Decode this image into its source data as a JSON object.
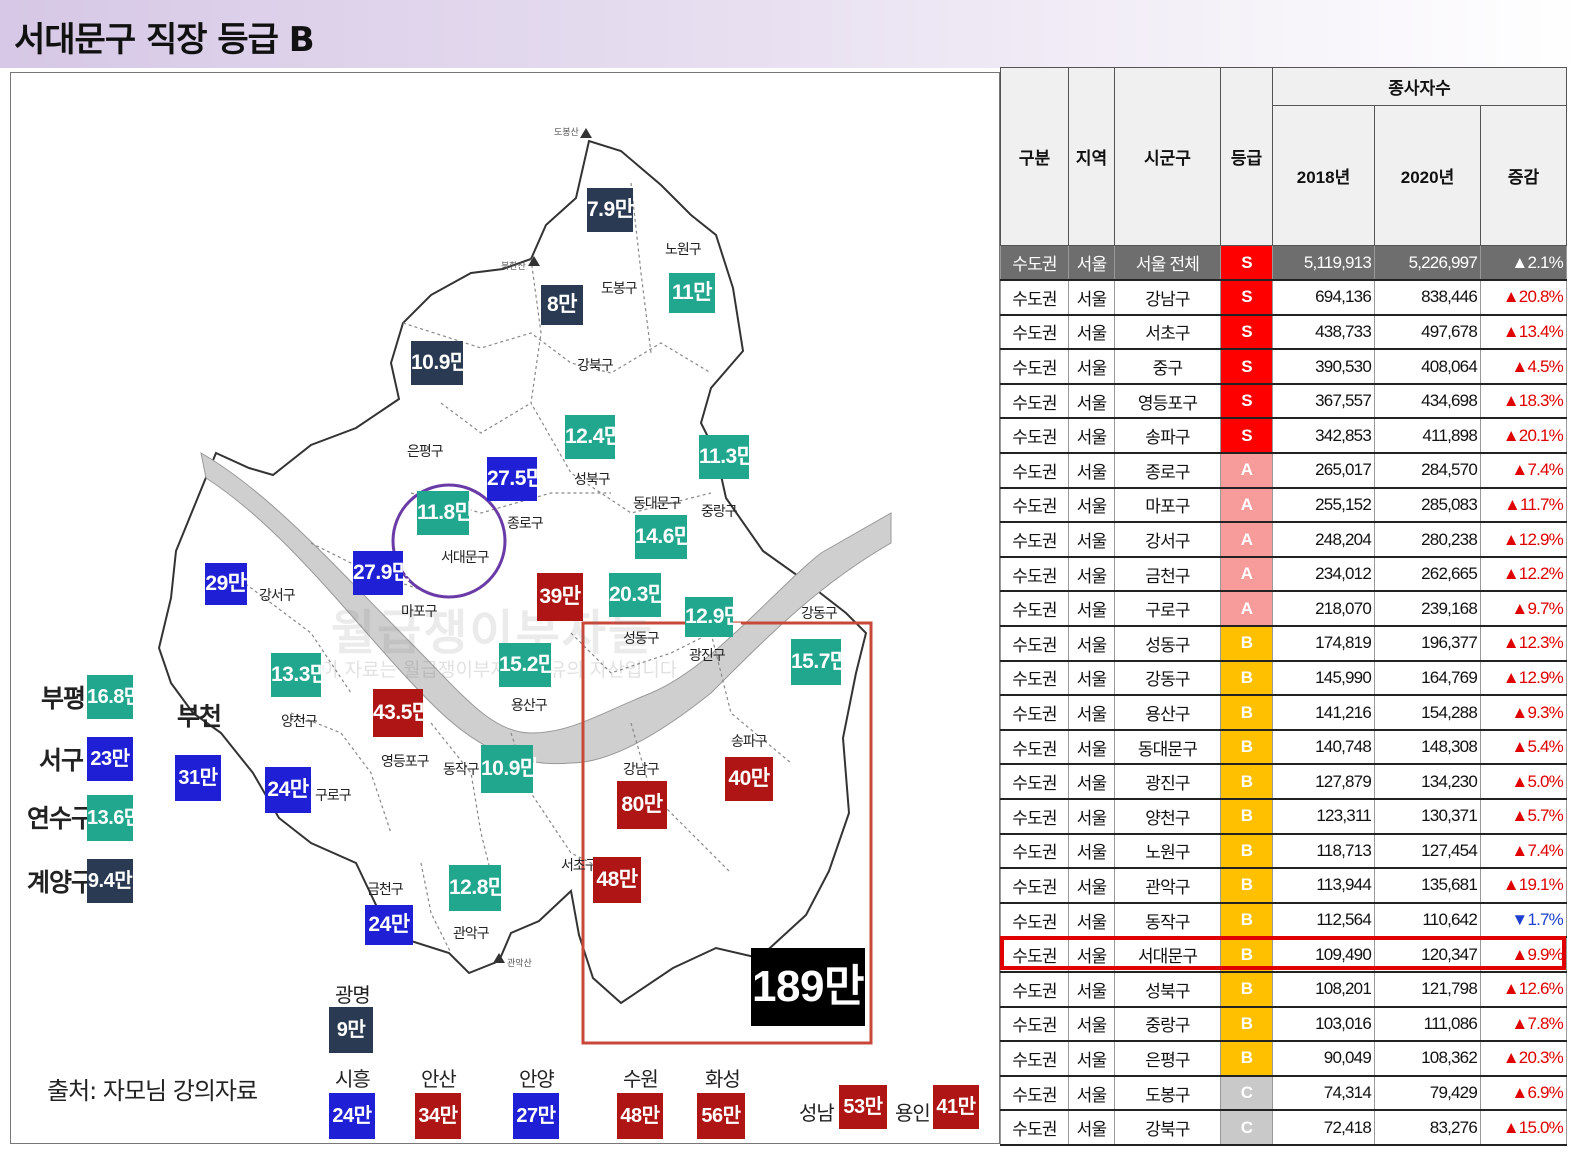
{
  "page": {
    "title": "서대문구 직장 등급 B"
  },
  "map": {
    "mountains": [
      "도봉산",
      "북한산",
      "관악산"
    ],
    "districts": [
      "노원구",
      "도봉구",
      "강북구",
      "은평구",
      "성북구",
      "종로구",
      "동대문구",
      "중랑구",
      "서대문구",
      "강서구",
      "마포구",
      "성동구",
      "광진구",
      "강동구",
      "양천구",
      "용산구",
      "영등포구",
      "동작구",
      "구로구",
      "송파구",
      "강남구",
      "서초구",
      "금천구",
      "관악구"
    ],
    "values": {
      "dobong": "7.9만",
      "gangbuk": "8만",
      "nowon": "11만",
      "eunpyeong": "10.9만",
      "seongbuk": "12.4만",
      "jungnang": "11.3만",
      "jongno": "27.5만",
      "seodaemun": "11.8만",
      "dongdaemun": "14.6만",
      "gangseo": "29만",
      "mapo": "27.9만",
      "jung": "39만",
      "seongdong": "20.3만",
      "gwangjin": "12.9만",
      "gangdong": "15.7만",
      "yangcheon": "13.3만",
      "yongsan": "15.2만",
      "yeongdeungpo": "43.5만",
      "dongjak": "10.9만",
      "guro": "24만",
      "songpa": "40만",
      "gangnam": "80만",
      "seocho": "48만",
      "geumcheon": "24만",
      "gwanak": "12.8만",
      "gangnam3_total": "189만"
    },
    "outer_cities": [
      {
        "name": "부평",
        "value": "16.8만"
      },
      {
        "name": "서구",
        "value": "23만"
      },
      {
        "name": "연수구",
        "value": "13.6만"
      },
      {
        "name": "계양구",
        "value": "9.4만"
      },
      {
        "name": "부천",
        "value": "31만"
      },
      {
        "name": "광명",
        "value": "9만"
      },
      {
        "name": "시흥",
        "value": "24만"
      },
      {
        "name": "안산",
        "value": "34만"
      },
      {
        "name": "안양",
        "value": "27만"
      },
      {
        "name": "수원",
        "value": "48만"
      },
      {
        "name": "화성",
        "value": "56만"
      },
      {
        "name": "성남",
        "value": "53만"
      },
      {
        "name": "용인",
        "value": "41만"
      }
    ],
    "source": "출처: 자모님 강의자료",
    "watermark": "월급쟁이부자들",
    "watermark_sub": "이 자료는 월급쟁이부자들 소유의 자산입니다"
  },
  "table": {
    "headers": {
      "gubun": "구분",
      "region": "지역",
      "sigungu": "시군구",
      "grade": "등급",
      "workers": "종사자수",
      "y2018": "2018년",
      "y2020": "2020년",
      "change": "증감"
    },
    "rows": [
      [
        "수도권",
        "서울",
        "서울 전체",
        "S",
        "5,119,913",
        "5,226,997",
        "▲2.1%"
      ],
      [
        "수도권",
        "서울",
        "강남구",
        "S",
        "694,136",
        "838,446",
        "▲20.8%"
      ],
      [
        "수도권",
        "서울",
        "서초구",
        "S",
        "438,733",
        "497,678",
        "▲13.4%"
      ],
      [
        "수도권",
        "서울",
        "중구",
        "S",
        "390,530",
        "408,064",
        "▲4.5%"
      ],
      [
        "수도권",
        "서울",
        "영등포구",
        "S",
        "367,557",
        "434,698",
        "▲18.3%"
      ],
      [
        "수도권",
        "서울",
        "송파구",
        "S",
        "342,853",
        "411,898",
        "▲20.1%"
      ],
      [
        "수도권",
        "서울",
        "종로구",
        "A",
        "265,017",
        "284,570",
        "▲7.4%"
      ],
      [
        "수도권",
        "서울",
        "마포구",
        "A",
        "255,152",
        "285,083",
        "▲11.7%"
      ],
      [
        "수도권",
        "서울",
        "강서구",
        "A",
        "248,204",
        "280,238",
        "▲12.9%"
      ],
      [
        "수도권",
        "서울",
        "금천구",
        "A",
        "234,012",
        "262,665",
        "▲12.2%"
      ],
      [
        "수도권",
        "서울",
        "구로구",
        "A",
        "218,070",
        "239,168",
        "▲9.7%"
      ],
      [
        "수도권",
        "서울",
        "성동구",
        "B",
        "174,819",
        "196,377",
        "▲12.3%"
      ],
      [
        "수도권",
        "서울",
        "강동구",
        "B",
        "145,990",
        "164,769",
        "▲12.9%"
      ],
      [
        "수도권",
        "서울",
        "용산구",
        "B",
        "141,216",
        "154,288",
        "▲9.3%"
      ],
      [
        "수도권",
        "서울",
        "동대문구",
        "B",
        "140,748",
        "148,308",
        "▲5.4%"
      ],
      [
        "수도권",
        "서울",
        "광진구",
        "B",
        "127,879",
        "134,230",
        "▲5.0%"
      ],
      [
        "수도권",
        "서울",
        "양천구",
        "B",
        "123,311",
        "130,371",
        "▲5.7%"
      ],
      [
        "수도권",
        "서울",
        "노원구",
        "B",
        "118,713",
        "127,454",
        "▲7.4%"
      ],
      [
        "수도권",
        "서울",
        "관악구",
        "B",
        "113,944",
        "135,681",
        "▲19.1%"
      ],
      [
        "수도권",
        "서울",
        "동작구",
        "B",
        "112,564",
        "110,642",
        "▼1.7%"
      ],
      [
        "수도권",
        "서울",
        "서대문구",
        "B",
        "109,490",
        "120,347",
        "▲9.9%"
      ],
      [
        "수도권",
        "서울",
        "성북구",
        "B",
        "108,201",
        "121,798",
        "▲12.6%"
      ],
      [
        "수도권",
        "서울",
        "중랑구",
        "B",
        "103,016",
        "111,086",
        "▲7.8%"
      ],
      [
        "수도권",
        "서울",
        "은평구",
        "B",
        "90,049",
        "108,362",
        "▲20.3%"
      ],
      [
        "수도권",
        "서울",
        "도봉구",
        "C",
        "74,314",
        "79,429",
        "▲6.9%"
      ],
      [
        "수도권",
        "서울",
        "강북구",
        "C",
        "72,418",
        "83,276",
        "▲15.0%"
      ]
    ],
    "highlighted_row": "서대문구",
    "colors": {
      "S": "#ff0000",
      "A": "#f79b9b",
      "B": "#ffc000",
      "C": "#c9c9c9",
      "up": "#e00000",
      "down": "#1f3fcf"
    }
  }
}
